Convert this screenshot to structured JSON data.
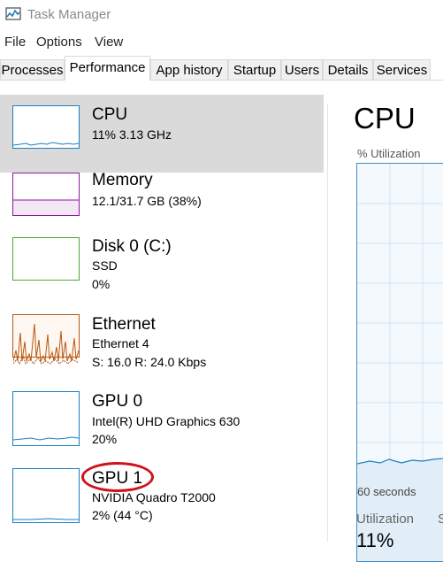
{
  "window": {
    "title": "Task Manager"
  },
  "menu": {
    "file": "File",
    "options": "Options",
    "view": "View"
  },
  "tabs": [
    {
      "label": "Processes"
    },
    {
      "label": "Performance"
    },
    {
      "label": "App history"
    },
    {
      "label": "Startup"
    },
    {
      "label": "Users"
    },
    {
      "label": "Details"
    },
    {
      "label": "Services"
    }
  ],
  "resources": [
    {
      "name": "CPU",
      "line1": "11%  3.13 GHz",
      "line2": "",
      "color": "#1a7fc1"
    },
    {
      "name": "Memory",
      "line1": "12.1/31.7 GB (38%)",
      "line2": "",
      "color": "#8b1aa0"
    },
    {
      "name": "Disk 0 (C:)",
      "line1": "SSD",
      "line2": "0%",
      "color": "#4da934"
    },
    {
      "name": "Ethernet",
      "line1": "Ethernet 4",
      "line2": "S: 16.0  R: 24.0 Kbps",
      "color": "#b8560e"
    },
    {
      "name": "GPU 0",
      "line1": "Intel(R) UHD Graphics 630",
      "line2": "20%",
      "color": "#1a7fc1"
    },
    {
      "name": "GPU 1",
      "line1": "NVIDIA Quadro T2000",
      "line2": "2%  (44 °C)",
      "color": "#1a7fc1"
    }
  ],
  "detail": {
    "title": "CPU",
    "ylabel": "% Utilization",
    "time_label": "60 seconds",
    "stat_label": "Utilization",
    "stat_label_2": "S",
    "stat_value": "11%"
  },
  "colors": {
    "selected_bg": "#dadada",
    "cpu_line": "#1a7fc1",
    "annotation": "#d0111b"
  }
}
